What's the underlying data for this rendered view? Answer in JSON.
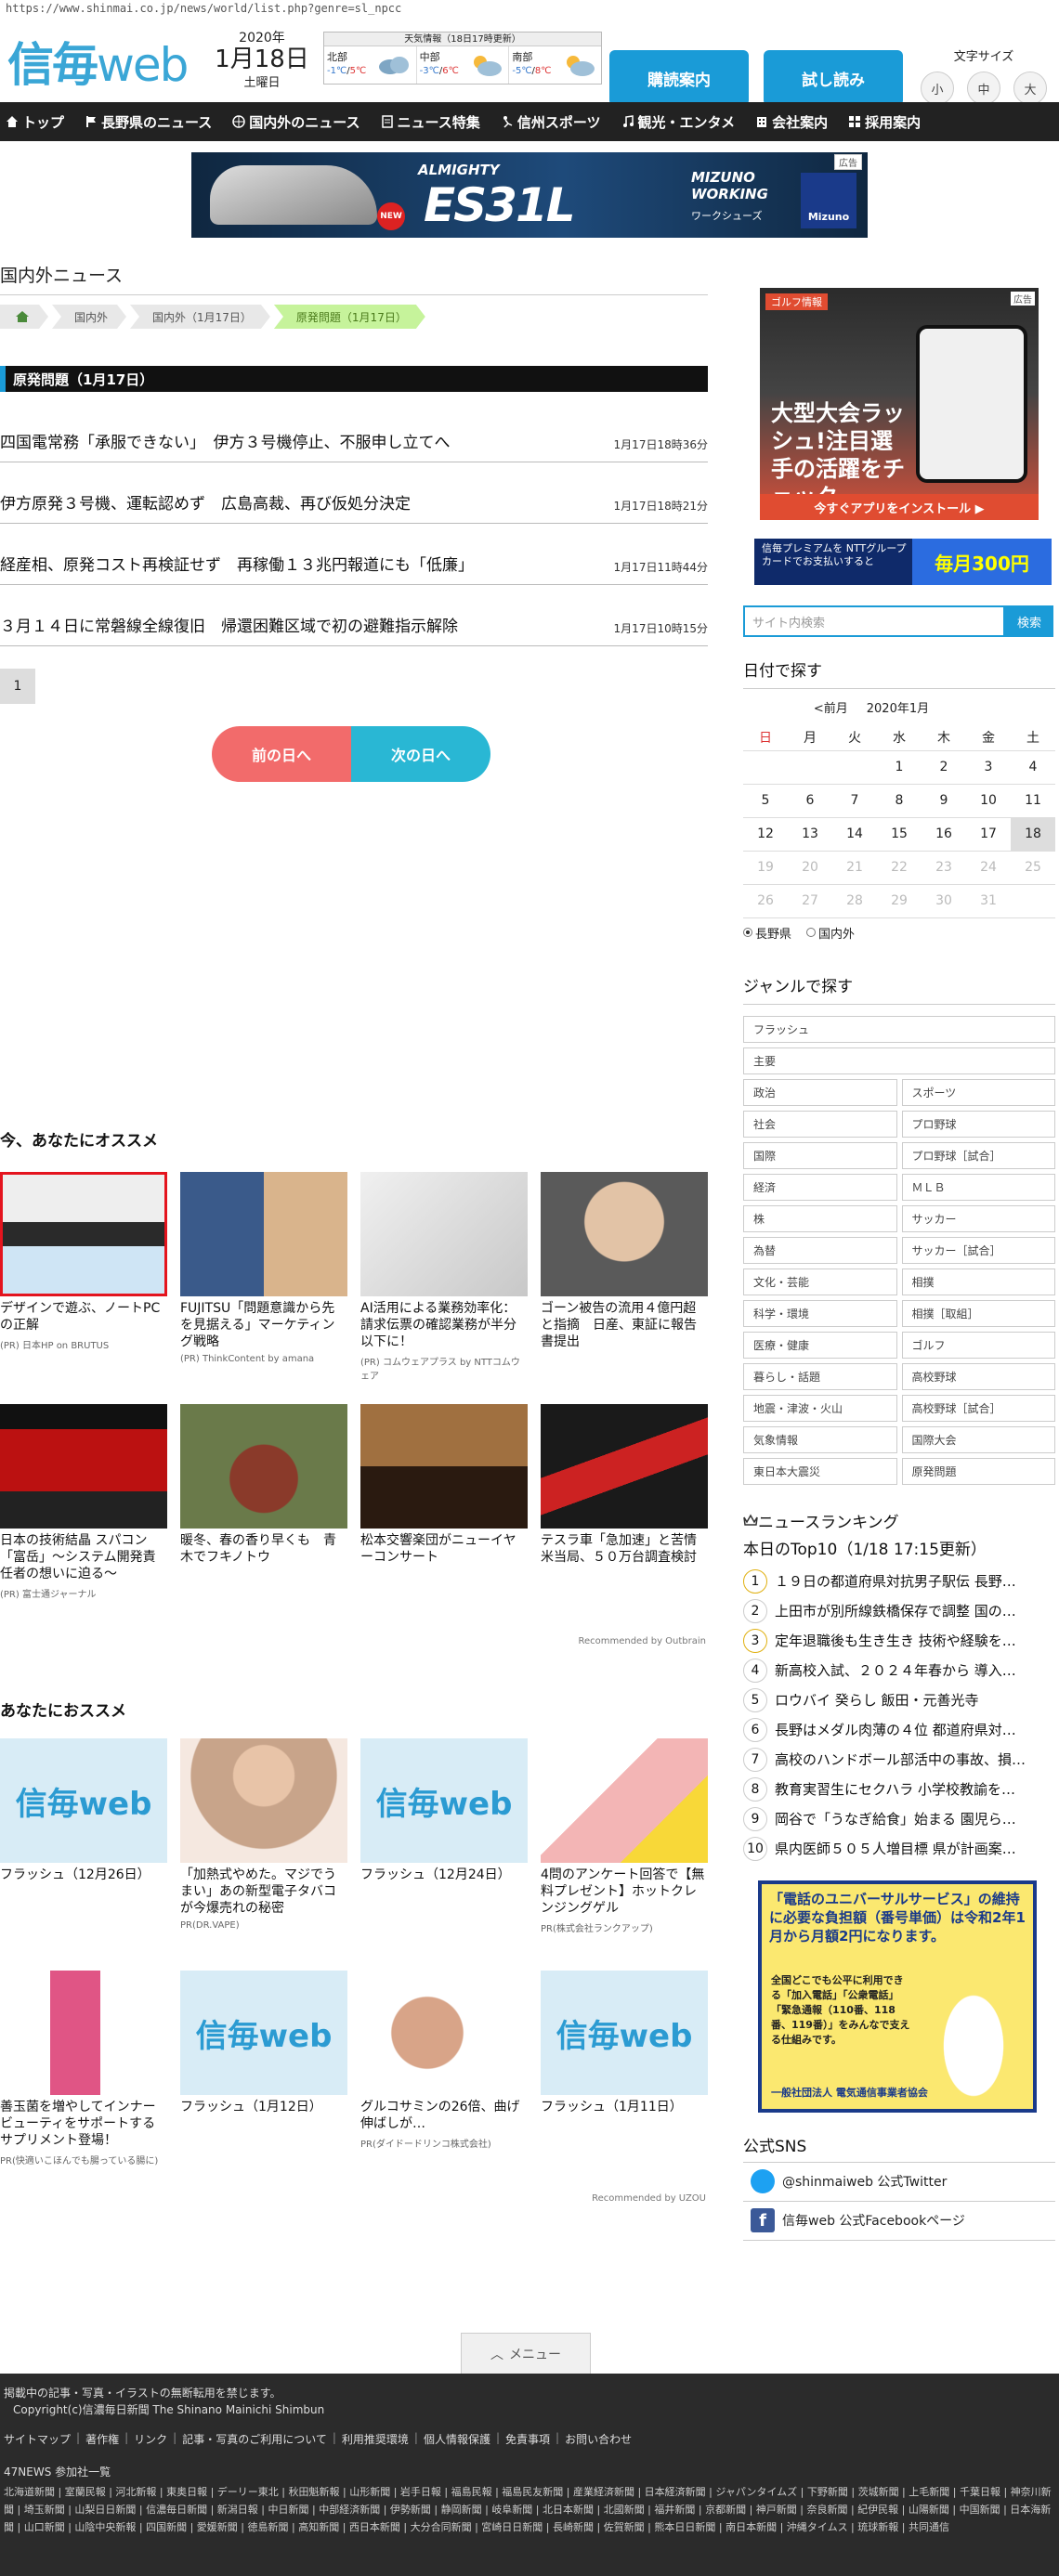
{
  "url": "https://www.shinmai.co.jp/news/world/list.php?genre=sl_npcc",
  "header": {
    "logo": {
      "mark": "信毎",
      "web": "web"
    },
    "date": {
      "year": "2020年",
      "monthday": "1月18日",
      "weekday": "土曜日"
    },
    "weather": {
      "title": "天気情報（18日17時更新）",
      "regions": [
        {
          "name": "北部",
          "low": "-1℃",
          "high": "5℃",
          "icon": "cloud-icon"
        },
        {
          "name": "中部",
          "low": "-3℃",
          "high": "6℃",
          "icon": "sun-cloud-icon"
        },
        {
          "name": "南部",
          "low": "-5℃",
          "high": "8℃",
          "icon": "sun-cloud-icon"
        }
      ]
    },
    "subscribe_label": "購読案内",
    "trial_label": "試し読み",
    "fontsize": {
      "label": "文字サイズ",
      "small": "小",
      "medium": "中",
      "large": "大"
    }
  },
  "nav": [
    {
      "label": "トップ",
      "icon": "home-icon"
    },
    {
      "label": "長野県のニュース",
      "icon": "flag-icon"
    },
    {
      "label": "国内外のニュース",
      "icon": "globe-icon"
    },
    {
      "label": "ニュース特集",
      "icon": "document-icon"
    },
    {
      "label": "信州スポーツ",
      "icon": "sports-icon"
    },
    {
      "label": "観光・エンタメ",
      "icon": "music-icon"
    },
    {
      "label": "会社案内",
      "icon": "building-icon"
    },
    {
      "label": "採用案内",
      "icon": "grid-icon"
    }
  ],
  "banner": {
    "tag": "広告",
    "brand": "ALMIGHTY",
    "model": "ES31L",
    "series_line1": "MIZUNO",
    "series_line2": "WORKING",
    "series_kana": "ワークシューズ",
    "new_label": "NEW",
    "maker": "Mizuno"
  },
  "main": {
    "title": "国内外ニュース",
    "breadcrumbs": [
      "国内外",
      "国内外（1月17日）",
      "原発問題（1月17日）"
    ],
    "section": "原発問題（1月17日）",
    "news": [
      {
        "title": "四国電常務「承服できない」　伊方３号機停止、不服申し立てへ",
        "time": "1月17日18時36分"
      },
      {
        "title": "伊方原発３号機、運転認めず　広島高裁、再び仮処分決定",
        "time": "1月17日18時21分"
      },
      {
        "title": "経産相、原発コスト再検証せず　再稼働１３兆円報道にも「低廉」",
        "time": "1月17日11時44分"
      },
      {
        "title": "３月１４日に常磐線全線復旧　帰還困難区域で初の避難指示解除",
        "time": "1月17日10時15分"
      }
    ],
    "page": "1",
    "prev_day": "前の日へ",
    "next_day": "次の日へ"
  },
  "rec1": {
    "title": "今、あなたにオススメ",
    "cards": [
      {
        "title": "デザインで遊ぶ、ノートPCの正解",
        "source": "(PR) 日本HP on BRUTUS"
      },
      {
        "title": "FUJITSU「問題意識から先を見据える」マーケティング戦略",
        "source": "(PR) ThinkContent by amana"
      },
      {
        "title": "AI活用による業務効率化：請求伝票の確認業務が半分以下に！",
        "source": "(PR) コムウェアプラス by NTTコムウェア"
      },
      {
        "title": "ゴーン被告の流用４億円超と指摘　日産、東証に報告書提出",
        "source": ""
      },
      {
        "title": "日本の技術結晶 スパコン「富岳」～システム開発責任者の想いに迫る～",
        "source": "(PR) 富士通ジャーナル"
      },
      {
        "title": "暖冬、春の香り早くも　青木でフキノトウ",
        "source": ""
      },
      {
        "title": "松本交響楽団がニューイヤーコンサート",
        "source": ""
      },
      {
        "title": "テスラ車「急加速」と苦情　米当局、５０万台調査検討",
        "source": ""
      }
    ],
    "recommended_by": "Recommended by Outbrain"
  },
  "rec2": {
    "title": "あなたにおススメ",
    "cards": [
      {
        "title": "フラッシュ（12月26日）",
        "source": "",
        "img": "信毎web"
      },
      {
        "title": "「加熱式やめた。マジでうまい」あの新型電子タバコが今爆売れの秘密",
        "source": "PR(DR.VAPE)",
        "img": ""
      },
      {
        "title": "フラッシュ（12月24日）",
        "source": "",
        "img": "信毎web"
      },
      {
        "title": "4問のアンケート回答で【無料プレゼント】ホットクレンジングゲル",
        "source": "PR(株式会社ランクアップ)",
        "img": ""
      },
      {
        "title": "善玉菌を増やしてインナービューティをサポートするサプリメント登場！",
        "source": "PR(快適いこほんでも腸っている腸に)",
        "img": ""
      },
      {
        "title": "フラッシュ（1月12日）",
        "source": "",
        "img": "信毎web"
      },
      {
        "title": "グルコサミンの26倍、曲げ伸ばしが…",
        "source": "PR(ダイドードリンコ株式会社)",
        "img": ""
      },
      {
        "title": "フラッシュ（1月11日）",
        "source": "",
        "img": "信毎web"
      }
    ],
    "recommended_by": "Recommended by UZOU"
  },
  "side": {
    "ad_golf": {
      "tag": "ゴルフ情報",
      "adtag": "広告",
      "headline": "大型大会ラッシュ!注目選手の活躍をチェック",
      "cta": "今すぐアプリをインストール ▶"
    },
    "ad_premium": {
      "left": "信毎プレミアムを NTTグループカードでお支払いすると",
      "right": "毎月300円"
    },
    "search": {
      "placeholder": "サイト内検索",
      "button": "検索"
    },
    "calendar": {
      "title": "日付で探す",
      "prev": "<前月",
      "month": "2020年1月",
      "weekdays": [
        "日",
        "月",
        "火",
        "水",
        "木",
        "金",
        "土"
      ],
      "weeks": [
        [
          "",
          "",
          "",
          "1",
          "2",
          "3",
          "4"
        ],
        [
          "5",
          "6",
          "7",
          "8",
          "9",
          "10",
          "11"
        ],
        [
          "12",
          "13",
          "14",
          "15",
          "16",
          "17",
          "18"
        ],
        [
          "19",
          "20",
          "21",
          "22",
          "23",
          "24",
          "25"
        ],
        [
          "26",
          "27",
          "28",
          "29",
          "30",
          "31",
          ""
        ]
      ],
      "radio_nagano": "長野県",
      "radio_world": "国内外"
    },
    "genre_title": "ジャンルで探す",
    "genres_full": [
      "フラッシュ",
      "主要"
    ],
    "genres": [
      "政治",
      "スポーツ",
      "社会",
      "プロ野球",
      "国際",
      "プロ野球［試合］",
      "経済",
      "ＭＬＢ",
      "株",
      "サッカー",
      "為替",
      "サッカー［試合］",
      "文化・芸能",
      "相撲",
      "科学・環境",
      "相撲［取組］",
      "医療・健康",
      "ゴルフ",
      "暮らし・話題",
      "高校野球",
      "地震・津波・火山",
      "高校野球［試合］",
      "気象情報",
      "国際大会",
      "東日本大震災",
      "原発問題"
    ],
    "ranking": {
      "title": "ニュースランキング",
      "subtitle": "本日のTop10（1/18 17:15更新）",
      "items": [
        "１９日の都道府県対抗男子駅伝 長野…",
        "上田市が別所線鉄橋保存で調整 国の…",
        "定年退職後も生き生き 技術や経験を…",
        "新高校入試、２０２４年春から 導入…",
        "ロウバイ 癸らし 飯田・元善光寺",
        "長野はメダル肉薄の４位 都道府県対…",
        "高校のハンドボール部活中の事故、損…",
        "教育実習生にセクハラ 小学校教諭を…",
        "岡谷で「うなぎ給食」始まる 園児ら…",
        "県内医師５０５人増目標 県が計画案…"
      ]
    },
    "ad_univ": {
      "line1": "「電話のユニバーサルサービス」の維持に必要な負担額（番号単価）は令和2年1月から月額2円になります。",
      "line2": "全国どこでも公平に利用できる「加入電話」「公衆電話」「緊急通報（110番、118番、119番）」をみんなで支える仕組みです。",
      "line3": "一般社団法人 電気通信事業者協会"
    },
    "sns_title": "公式SNS",
    "twitter": "@shinmaiweb 公式Twitter",
    "facebook": "信毎web 公式Facebookページ"
  },
  "footer": {
    "menu": "メニュー",
    "notice": "掲載中の記事・写真・イラストの無断転用を禁じます。",
    "copyright": "Copyright(c)信濃毎日新聞 The Shinano Mainichi Shimbun",
    "links": [
      "サイトマップ",
      "著作権",
      "リンク",
      "記事・写真のご利用について",
      "利用推奨環境",
      "個人情報保護",
      "免責事項",
      "お問い合わせ"
    ],
    "news47": "47NEWS 参加社一覧",
    "papers": "北海道新聞 | 室蘭民報 | 河北新報 | 東奥日報 | デーリー東北 | 秋田魁新報 | 山形新聞 | 岩手日報 | 福島民報 | 福島民友新聞 | 産業経済新聞 | 日本経済新聞 | ジャパンタイムズ | 下野新聞 | 茨城新聞 | 上毛新聞 | 千葉日報 | 神奈川新聞 | 埼玉新聞 | 山梨日日新聞 | 信濃毎日新聞 | 新潟日報 | 中日新聞 | 中部経済新聞 | 伊勢新聞 | 静岡新聞 | 岐阜新聞 | 北日本新聞 | 北國新聞 | 福井新聞 | 京都新聞 | 神戸新聞 | 奈良新聞 | 紀伊民報 | 山陽新聞 | 中国新聞 | 日本海新聞 | 山口新聞 | 山陰中央新報 | 四国新聞 | 愛媛新聞 | 徳島新聞 | 高知新聞 | 西日本新聞 | 大分合同新聞 | 宮崎日日新聞 | 長崎新聞 | 佐賀新聞 | 熊本日日新聞 | 南日本新聞 | 沖縄タイムス | 琉球新報 | 共同通信"
  }
}
